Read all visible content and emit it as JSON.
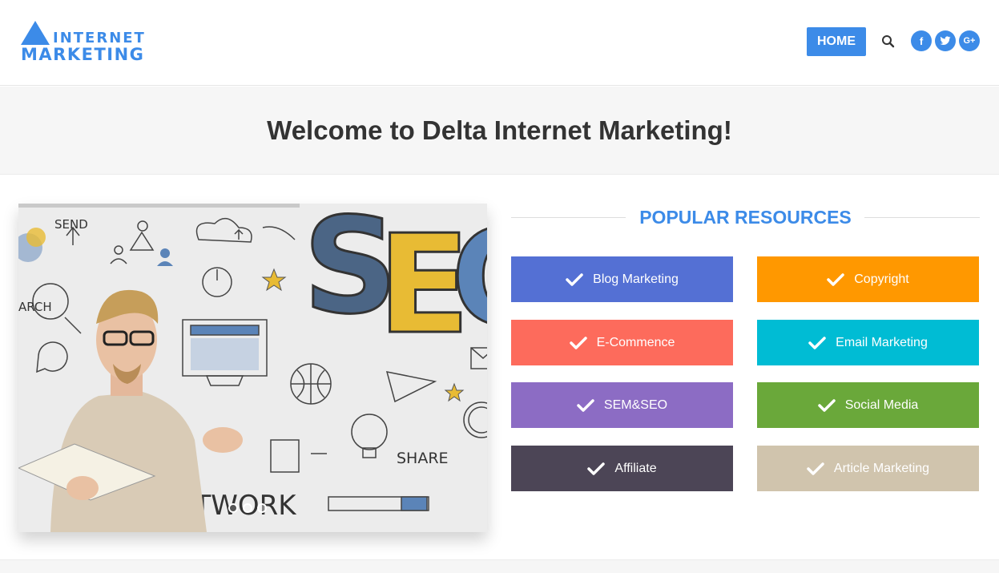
{
  "header": {
    "logo_top": "INTERNET",
    "logo_bottom": "MARKETING",
    "nav_home": "HOME",
    "social": {
      "facebook": "f",
      "twitter": "t",
      "googleplus": "G+"
    }
  },
  "title": "Welcome to Delta Internet Marketing!",
  "slider": {
    "progress": 0.6,
    "words": {
      "send": "SEND",
      "share": "SHARE",
      "network": "ETWORK",
      "seo": "SEO",
      "search": "ARCH"
    },
    "dots": 3,
    "active_dot": 0
  },
  "resources": {
    "heading": "POPULAR RESOURCES",
    "items": [
      {
        "label": "Blog Marketing",
        "color": "#5470d4"
      },
      {
        "label": "Copyright",
        "color": "#ff9800"
      },
      {
        "label": "E-Commence",
        "color": "#fd6b5c"
      },
      {
        "label": "Email Marketing",
        "color": "#00bcd4"
      },
      {
        "label": "SEM&SEO",
        "color": "#8c6cc4"
      },
      {
        "label": "Social Media",
        "color": "#6aa83a"
      },
      {
        "label": "Affiliate",
        "color": "#4c4556"
      },
      {
        "label": "Article Marketing",
        "color": "#d0c4ad"
      }
    ]
  },
  "colors": {
    "accent": "#3c8be8"
  }
}
